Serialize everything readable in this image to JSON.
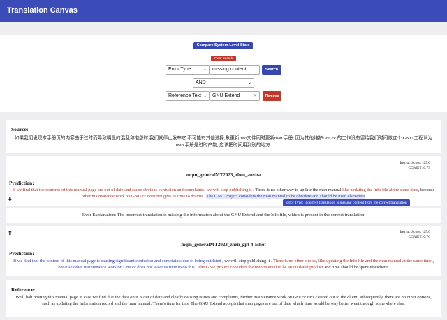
{
  "app": {
    "title": "Translation Canvas"
  },
  "search": {
    "compare_label": "Compare System-Level Stats",
    "clear_label": "Clear Search",
    "row1": {
      "field": "Error Type",
      "value": "missing content",
      "button": "Search"
    },
    "operator": "AND",
    "row2": {
      "field": "Reference Text",
      "value": "GNU Extend",
      "button": "Remove"
    }
  },
  "source": {
    "label": "Source:",
    "text": "如果我们发现本手册页的内容由于过时而导致明显的混乱和抱怨时,我们就停止发布它.不可能有其他选择,象更新Info文件同时更新man 手册; 因为其他维护Gnu cc 的工作没有留给我们时间做这个.GNU 工程认为man 手册是过时产物, 应该把时间用到别的地方."
  },
  "prediction1": {
    "meta_score": "InstructScore: -25.0",
    "meta_comet": "COMET: 0.75",
    "system": "mqm_generalMT2023_zhen_anvita",
    "label": "Prediction:",
    "segments": [
      {
        "t": "If we find that the contents of this manual page are out of date and cause obvious confusion and complaints, we will stop publishing it",
        "c": "red"
      },
      {
        "t": " . There is no other way to update the man manual ",
        "c": ""
      },
      {
        "t": "like updating the Info file at the same time",
        "c": "red"
      },
      {
        "t": ", because ",
        "c": ""
      },
      {
        "t": "other maintenance work on GNU cc does not give us time to do this",
        "c": "red"
      },
      {
        "t": " . ",
        "c": ""
      },
      {
        "t": "The GNU Project considers the man manual to be obsolete and should be used elsewhere",
        "c": "blue hl"
      }
    ],
    "tooltip": "Error Type: Incorrect translation is missing content from the correct translation",
    "arrow": "⬇",
    "explanation": "Error Explanation: The incorrect translation is missing the information about the GNU Extend and the Info file, which is present in the correct translation."
  },
  "prediction2": {
    "arrow": "⬆",
    "meta_score": "InstructScore: -25.0",
    "meta_comet": "COMET: 0.76",
    "system": "mqm_generalMT2023_zhen_gpt-4-5shot",
    "label": "Prediction:",
    "segments": [
      {
        "t": "If we find that the content of this manual page is causing significant confusion and complaints due to being outdated",
        "c": "blue"
      },
      {
        "t": " , we will stop publishing it . ",
        "c": ""
      },
      {
        "t": "There is no other choice, like updating the Info file and the man manual at the same time",
        "c": "red"
      },
      {
        "t": " , ",
        "c": ""
      },
      {
        "t": "because other maintenance work on Gnu cc does not leave us time to do this",
        "c": "blue"
      },
      {
        "t": " . ",
        "c": ""
      },
      {
        "t": "The GNU project considers the man manual to be an outdated product",
        "c": "red"
      },
      {
        "t": " and time should be spent elsewhere.",
        "c": ""
      }
    ]
  },
  "reference": {
    "label": "Reference:",
    "text": "We'll halt posting this manual page in case we find that the data on it is out of date and clearly causing issues and complaints, further maintenance work on Gnu cc isn't cleared out to the client, subsequently, there are no other options, such as updating the Information record and the man manual. There's time for this. The GNU Extend accepts that man pages are out of date which time would be way better went through somewhere else."
  }
}
